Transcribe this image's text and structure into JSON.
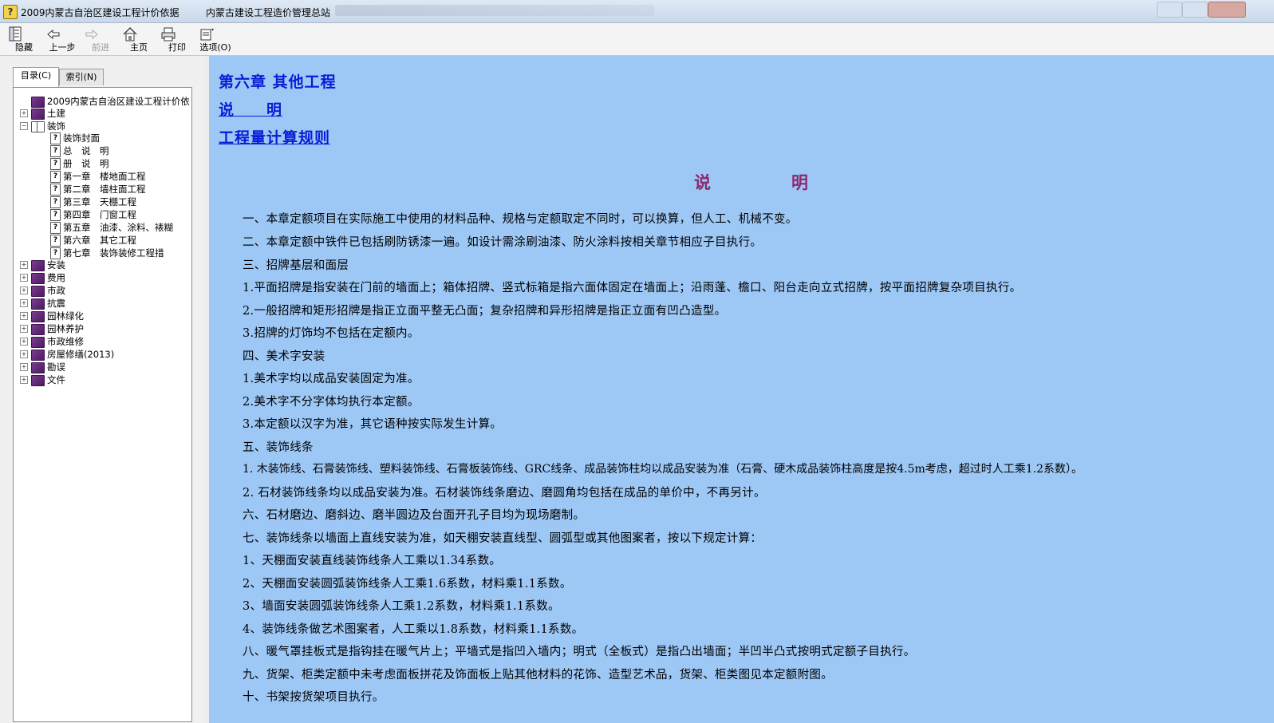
{
  "window": {
    "title": "2009内蒙古自治区建设工程计价依据",
    "subtitle": "内蒙古建设工程造价管理总站"
  },
  "toolbar": {
    "buttons": [
      {
        "label": "隐藏",
        "icon": "hide-icon"
      },
      {
        "label": "上一步",
        "icon": "back-arrow-icon"
      },
      {
        "label": "前进",
        "icon": "forward-arrow-icon"
      },
      {
        "label": "主页",
        "icon": "home-icon"
      },
      {
        "label": "打印",
        "icon": "print-icon"
      },
      {
        "label": "选项(O)",
        "icon": "options-icon"
      }
    ]
  },
  "tabs": {
    "contents": "目录(C)",
    "index": "索引(N)"
  },
  "tree": {
    "root": "2009内蒙古自治区建设工程计价依",
    "top_items": [
      "土建",
      "装饰"
    ],
    "decoration_children": [
      "装饰封面",
      "总　说　明",
      "册　说　明",
      "第一章　楼地面工程",
      "第二章　墙柱面工程",
      "第三章　天棚工程",
      "第四章　门窗工程",
      "第五章　油漆、涂料、裱糊",
      "第六章　其它工程",
      "第七章　装饰装修工程措"
    ],
    "other_items": [
      "安装",
      "费用",
      "市政",
      "抗震",
      "园林绿化",
      "园林养护",
      "市政维修",
      "房屋修缮(2013)",
      "勘误",
      "文件"
    ]
  },
  "content": {
    "links": [
      "第六章  其他工程",
      "说　　明",
      "工程量计算规则"
    ],
    "heading_left": "说",
    "heading_right": "明",
    "paragraphs": [
      "一、本章定额项目在实际施工中使用的材料品种、规格与定额取定不同时，可以换算，但人工、机械不变。",
      "二、本章定额中铁件已包括刷防锈漆一遍。如设计需涂刷油漆、防火涂料按相关章节相应子目执行。",
      "三、招牌基层和面层",
      "1.平面招牌是指安装在门前的墙面上；箱体招牌、竖式标箱是指六面体固定在墙面上；沿雨蓬、檐口、阳台走向立式招牌，按平面招牌复杂项目执行。",
      "2.一般招牌和矩形招牌是指正立面平整无凸面；复杂招牌和异形招牌是指正立面有凹凸造型。",
      "3.招牌的灯饰均不包括在定额内。",
      "四、美术字安装",
      "1.美术字均以成品安装固定为准。",
      "2.美术字不分字体均执行本定额。",
      "3.本定额以汉字为准，其它语种按实际发生计算。",
      "五、装饰线条",
      "1. 木装饰线、石膏装饰线、塑料装饰线、石膏板装饰线、GRC线条、成品装饰柱均以成品安装为准（石膏、硬木成品装饰柱高度是按4.5m考虑，超过时人工乘1.2系数）。",
      "2. 石材装饰线条均以成品安装为准。石材装饰线条磨边、磨圆角均包括在成品的单价中，不再另计。",
      "六、石材磨边、磨斜边、磨半圆边及台面开孔子目均为现场磨制。",
      "七、装饰线条以墙面上直线安装为准，如天棚安装直线型、圆弧型或其他图案者，按以下规定计算：",
      "1、天棚面安装直线装饰线条人工乘以1.34系数。",
      "2、天棚面安装圆弧装饰线条人工乘1.6系数，材料乘1.1系数。",
      "3、墙面安装圆弧装饰线条人工乘1.2系数，材料乘1.1系数。",
      "4、装饰线条做艺术图案者，人工乘以1.8系数，材料乘1.1系数。",
      "八、暖气罩挂板式是指钩挂在暖气片上；平墙式是指凹入墙内；明式（全板式）是指凸出墙面；半凹半凸式按明式定额子目执行。",
      "九、货架、柜类定额中未考虑面板拼花及饰面板上贴其他材料的花饰、造型艺术品，货架、柜类图见本定额附图。",
      "十、书架按货架项目执行。"
    ]
  }
}
